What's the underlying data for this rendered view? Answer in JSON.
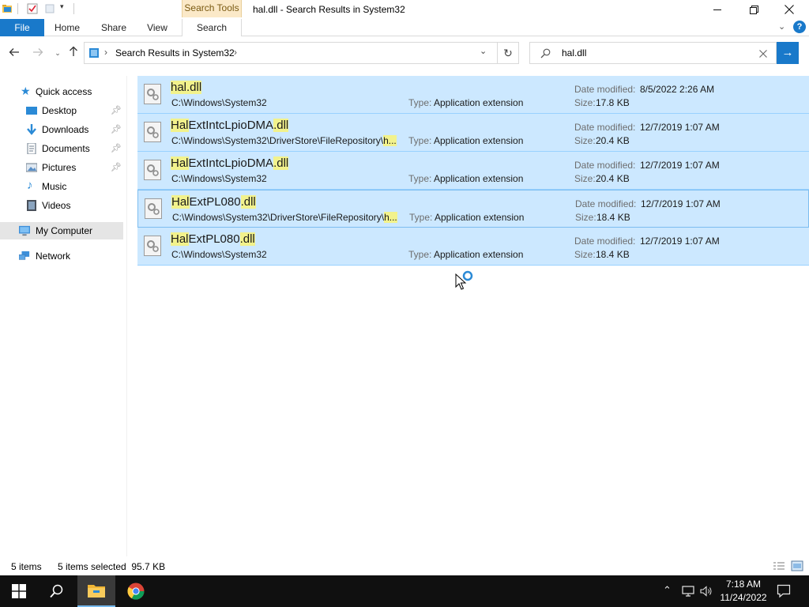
{
  "window": {
    "title": "hal.dll - Search Results in System32",
    "contextual_tab": "Search Tools",
    "controls": {
      "minimize": "—",
      "restore": "❐",
      "close": "✕"
    }
  },
  "ribbon": {
    "tabs": [
      "File",
      "Home",
      "Share",
      "View",
      "Search"
    ],
    "active_tab": "Search",
    "accent": "#1979ca"
  },
  "address": {
    "path": [
      "Search Results in System32"
    ],
    "search_value": "hal.dll"
  },
  "sidebar": {
    "quick_access": "Quick access",
    "pinned": [
      {
        "label": "Desktop",
        "icon": "desktop-icon",
        "pinned": true
      },
      {
        "label": "Downloads",
        "icon": "downloads-icon",
        "pinned": true
      },
      {
        "label": "Documents",
        "icon": "documents-icon",
        "pinned": true
      },
      {
        "label": "Pictures",
        "icon": "pictures-icon",
        "pinned": true
      },
      {
        "label": "Music",
        "icon": "music-icon",
        "pinned": false
      },
      {
        "label": "Videos",
        "icon": "videos-icon",
        "pinned": false
      }
    ],
    "this_pc": "My Computer",
    "network": "Network"
  },
  "results": [
    {
      "name_hl": "hal.dll",
      "name_rest": "",
      "name_hl2": "",
      "path": "C:\\Windows\\System32",
      "path_hl": "",
      "type_label": "Type:",
      "type": "Application extension",
      "date_label": "Date modified:",
      "date": "8/5/2022 2:26 AM",
      "size_label": "Size:",
      "size": "17.8 KB"
    },
    {
      "name_hl": "Hal",
      "name_rest": "ExtIntcLpioDMA",
      "name_hl2": ".dll",
      "path": "C:\\Windows\\System32\\DriverStore\\FileRepository\\",
      "path_hl": "h...",
      "type_label": "Type:",
      "type": "Application extension",
      "date_label": "Date modified:",
      "date": "12/7/2019 1:07 AM",
      "size_label": "Size:",
      "size": "20.4 KB"
    },
    {
      "name_hl": "Hal",
      "name_rest": "ExtIntcLpioDMA",
      "name_hl2": ".dll",
      "path": "C:\\Windows\\System32",
      "path_hl": "",
      "type_label": "Type:",
      "type": "Application extension",
      "date_label": "Date modified:",
      "date": "12/7/2019 1:07 AM",
      "size_label": "Size:",
      "size": "20.4 KB"
    },
    {
      "name_hl": "Hal",
      "name_rest": "ExtPL080",
      "name_hl2": ".dll",
      "path": "C:\\Windows\\System32\\DriverStore\\FileRepository\\",
      "path_hl": "h...",
      "type_label": "Type:",
      "type": "Application extension",
      "date_label": "Date modified:",
      "date": "12/7/2019 1:07 AM",
      "size_label": "Size:",
      "size": "18.4 KB"
    },
    {
      "name_hl": "Hal",
      "name_rest": "ExtPL080",
      "name_hl2": ".dll",
      "path": "C:\\Windows\\System32",
      "path_hl": "",
      "type_label": "Type:",
      "type": "Application extension",
      "date_label": "Date modified:",
      "date": "12/7/2019 1:07 AM",
      "size_label": "Size:",
      "size": "18.4 KB"
    }
  ],
  "status": {
    "item_count": "5 items",
    "selection": "5 items selected  95.7 KB"
  },
  "taskbar": {
    "time": "7:18 AM",
    "date": "11/24/2022"
  }
}
